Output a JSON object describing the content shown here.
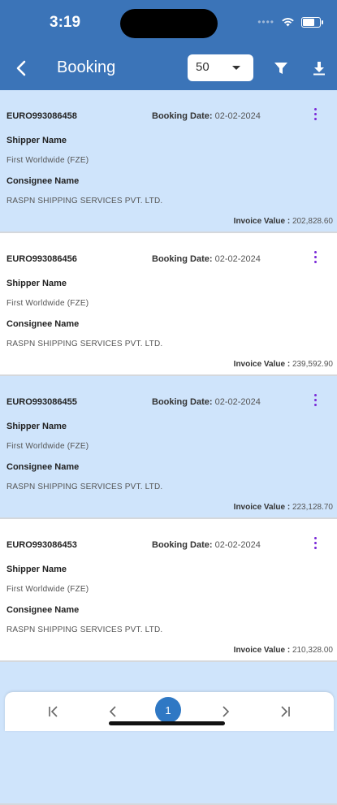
{
  "status_bar": {
    "time": "3:19",
    "battery_level": 0.8
  },
  "header": {
    "title": "Booking",
    "page_size": "50",
    "color": "#3b74b8"
  },
  "labels": {
    "booking_date": "Booking Date:",
    "shipper": "Shipper Name",
    "consignee": "Consignee Name",
    "invoice": "Invoice Value :"
  },
  "bookings": [
    {
      "id": "EURO993086458",
      "date": "02-02-2024",
      "shipper": "First Worldwide  (FZE)",
      "consignee": "RASPN SHIPPING SERVICES PVT. LTD.",
      "invoice": "202,828.60"
    },
    {
      "id": "EURO993086456",
      "date": "02-02-2024",
      "shipper": "First Worldwide  (FZE)",
      "consignee": "RASPN SHIPPING SERVICES PVT. LTD.",
      "invoice": "239,592.90"
    },
    {
      "id": "EURO993086455",
      "date": "02-02-2024",
      "shipper": "First Worldwide  (FZE)",
      "consignee": "RASPN SHIPPING SERVICES PVT. LTD.",
      "invoice": "223,128.70"
    },
    {
      "id": "EURO993086453",
      "date": "02-02-2024",
      "shipper": "First Worldwide  (FZE)",
      "consignee": "RASPN SHIPPING SERVICES PVT. LTD.",
      "invoice": "210,328.00"
    }
  ],
  "pagination": {
    "current_page": "1"
  },
  "colors": {
    "highlight_row": "#cfe4fb",
    "accent_purple": "#7b2bd8",
    "page_active": "#2f78c4"
  }
}
